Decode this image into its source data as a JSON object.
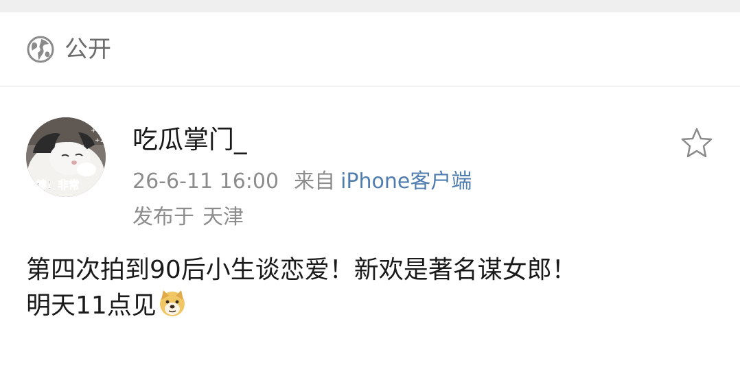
{
  "visibility": {
    "icon": "globe-icon",
    "label": "公开"
  },
  "post": {
    "author": "吃瓜掌门_",
    "avatar_caption": "棒！非常",
    "time": "26-6-11 16:00",
    "from_label": "来自",
    "client": "iPhone客户端",
    "location_label": "发布于",
    "location": "天津",
    "text_line1": "第四次拍到90后小生谈恋爱！新欢是著名谋女郎！",
    "text_line2": "明天11点见",
    "emoji": "doge-emoji-icon",
    "favorite_icon": "star-outline-icon"
  },
  "colors": {
    "link": "#507daf",
    "meta": "#8c8c8c",
    "text": "#1a1a1a"
  }
}
